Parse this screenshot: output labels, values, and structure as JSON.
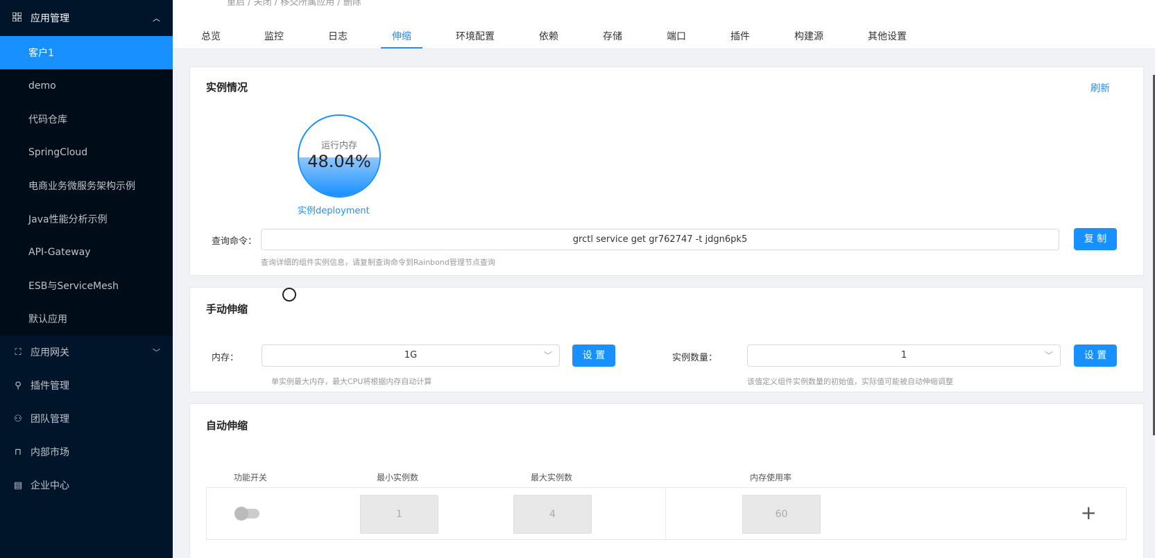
{
  "sidebar": {
    "top": {
      "label": "应用管理",
      "icon": "grid-icon"
    },
    "subitems": [
      {
        "label": "客户1",
        "active": true
      },
      {
        "label": "demo"
      },
      {
        "label": "代码仓库"
      },
      {
        "label": "SpringCloud"
      },
      {
        "label": "电商业务微服务架构示例"
      },
      {
        "label": "Java性能分析示例"
      },
      {
        "label": "API-Gateway"
      },
      {
        "label": "ESB与ServiceMesh"
      },
      {
        "label": "默认应用"
      }
    ],
    "items": [
      {
        "label": "应用网关",
        "icon": "gateway-icon",
        "expandable": true
      },
      {
        "label": "插件管理",
        "icon": "plugin-icon"
      },
      {
        "label": "团队管理",
        "icon": "team-icon"
      },
      {
        "label": "内部市场",
        "icon": "market-icon"
      },
      {
        "label": "企业中心",
        "icon": "enterprise-icon"
      }
    ]
  },
  "breadcrumb": "重启 / 关闭 / 移交所属应用 / 删除",
  "tabs": [
    {
      "label": "总览"
    },
    {
      "label": "监控"
    },
    {
      "label": "日志"
    },
    {
      "label": "伸缩",
      "active": true
    },
    {
      "label": "环境配置"
    },
    {
      "label": "依赖"
    },
    {
      "label": "存储"
    },
    {
      "label": "端口"
    },
    {
      "label": "插件"
    },
    {
      "label": "构建源"
    },
    {
      "label": "其他设置"
    }
  ],
  "instance": {
    "title": "实例情况",
    "refresh": "刷新",
    "gauge_label": "运行内存",
    "gauge_value": "48.04%",
    "gauge_fraction": 0.4804,
    "link": "实例deployment",
    "query_label": "查询命令：",
    "query_value": "grctl service get gr762747 -t jdgn6pk5",
    "copy": "复 制",
    "hint": "查询详细的组件实例信息，请复制查询命令到Rainbond管理节点查询"
  },
  "manual": {
    "title": "手动伸缩",
    "memory_label": "内存：",
    "memory_value": "1G",
    "memory_set": "设 置",
    "memory_hint": "单实例最大内存，最大CPU将根据内存自动计算",
    "count_label": "实例数量：",
    "count_value": "1",
    "count_set": "设 置",
    "count_hint": "该值定义组件实例数量的初始值，实际值可能被自动伸缩调整"
  },
  "auto": {
    "title": "自动伸缩",
    "headers": {
      "switch": "功能开关",
      "min": "最小实例数",
      "max": "最大实例数",
      "mem": "内存使用率"
    },
    "min_value": "1",
    "max_value": "4",
    "mem_value": "60",
    "enabled": false
  }
}
